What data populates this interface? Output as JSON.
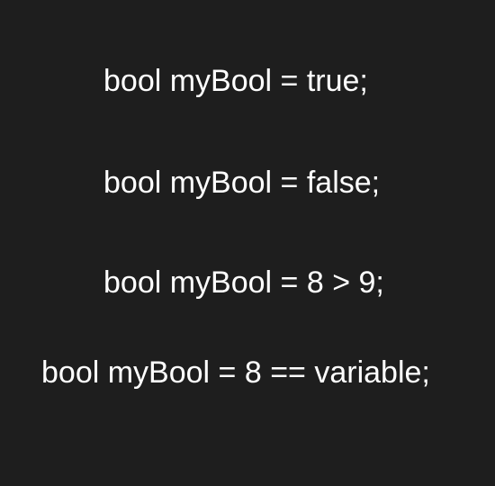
{
  "lines": [
    "bool myBool = true;",
    "bool myBool = false;",
    "bool myBool = 8 > 9;",
    "bool myBool = 8 == variable;"
  ],
  "colors": {
    "background": "#1e1e1e",
    "text": "#ffffff"
  }
}
